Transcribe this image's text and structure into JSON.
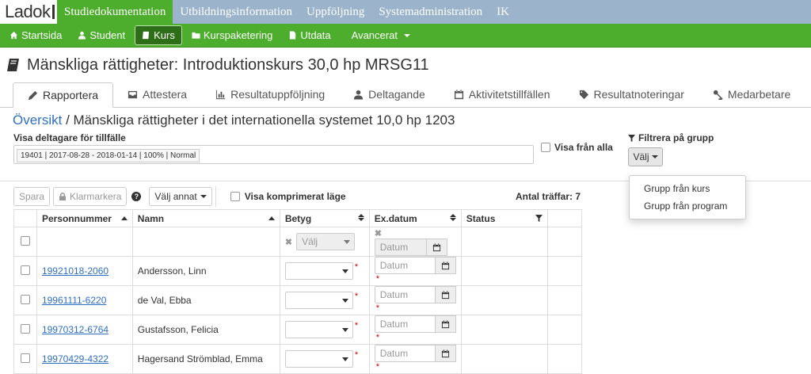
{
  "topbar": {
    "logo": "Ladok",
    "items": [
      {
        "label": "Studiedokumentation",
        "active": true
      },
      {
        "label": "Utbildningsinformation",
        "active": false
      },
      {
        "label": "Uppföljning",
        "active": false
      },
      {
        "label": "Systemadministration",
        "active": false
      },
      {
        "label": "IK",
        "active": false
      }
    ]
  },
  "greennav": {
    "items": [
      {
        "label": "Startsida",
        "icon": "home-icon"
      },
      {
        "label": "Student",
        "icon": "user-icon"
      },
      {
        "label": "Kurs",
        "icon": "book-icon",
        "active": true
      },
      {
        "label": "Kurspaketering",
        "icon": "folder-icon"
      },
      {
        "label": "Utdata",
        "icon": "file-icon"
      },
      {
        "label": "Avancerat",
        "icon": "none",
        "dropdown": true
      }
    ]
  },
  "page": {
    "title": "Mänskliga rättigheter: Introduktionskurs 30,0 hp MRSG11",
    "tabs": [
      {
        "label": "Rapportera",
        "icon": "pencil-icon",
        "active": true
      },
      {
        "label": "Attestera",
        "icon": "inbox-icon"
      },
      {
        "label": "Resultatuppföljning",
        "icon": "bar-chart-icon"
      },
      {
        "label": "Deltagande",
        "icon": "user-icon"
      },
      {
        "label": "Aktivitetstillfällen",
        "icon": "calendar-icon"
      },
      {
        "label": "Resultatnoteringar",
        "icon": "tag-icon"
      },
      {
        "label": "Medarbetare",
        "icon": "key-icon"
      }
    ],
    "breadcrumb_link": "Översikt",
    "breadcrumb_rest": " / Mänskliga rättigheter i det internationella systemet 10,0 hp 1203"
  },
  "filters": {
    "visa_label": "Visa deltagare för tillfälle",
    "selected_chip": "19401 | 2017-08-28 - 2018-01-14 | 100% | Normal",
    "visa_alla": "Visa från alla",
    "filtrera_label": "Filtrera på grupp",
    "valj_button": "Välj",
    "dropdown_items": [
      "Grupp från kurs",
      "Grupp från program"
    ]
  },
  "toolbar": {
    "spara": "Spara",
    "klarmarkera": "Klarmarkera",
    "help": "?",
    "valj_annat": "Välj annat",
    "visa_komprimerat": "Visa komprimerat läge",
    "antal_traffar": "Antal träffar: 7"
  },
  "table": {
    "headers": {
      "personnummer": "Personnummer",
      "namn": "Namn",
      "betyg": "Betyg",
      "exdatum": "Ex.datum",
      "status": "Status"
    },
    "filter": {
      "betyg_placeholder": "Välj",
      "datum_placeholder": "Datum"
    },
    "rows": [
      {
        "pnr": "19921018-2060",
        "namn": "Andersson, Linn",
        "datum": "Datum"
      },
      {
        "pnr": "19961111-6220",
        "namn": "de Val, Ebba",
        "datum": "Datum"
      },
      {
        "pnr": "19970312-6764",
        "namn": "Gustafsson, Felicia",
        "datum": "Datum"
      },
      {
        "pnr": "19970429-4322",
        "namn": "Hagersand Strömblad, Emma",
        "datum": "Datum"
      }
    ]
  },
  "colors": {
    "topbar_bg": "#9bb4cb",
    "green": "#4cae2c",
    "link": "#2f6fc0"
  }
}
